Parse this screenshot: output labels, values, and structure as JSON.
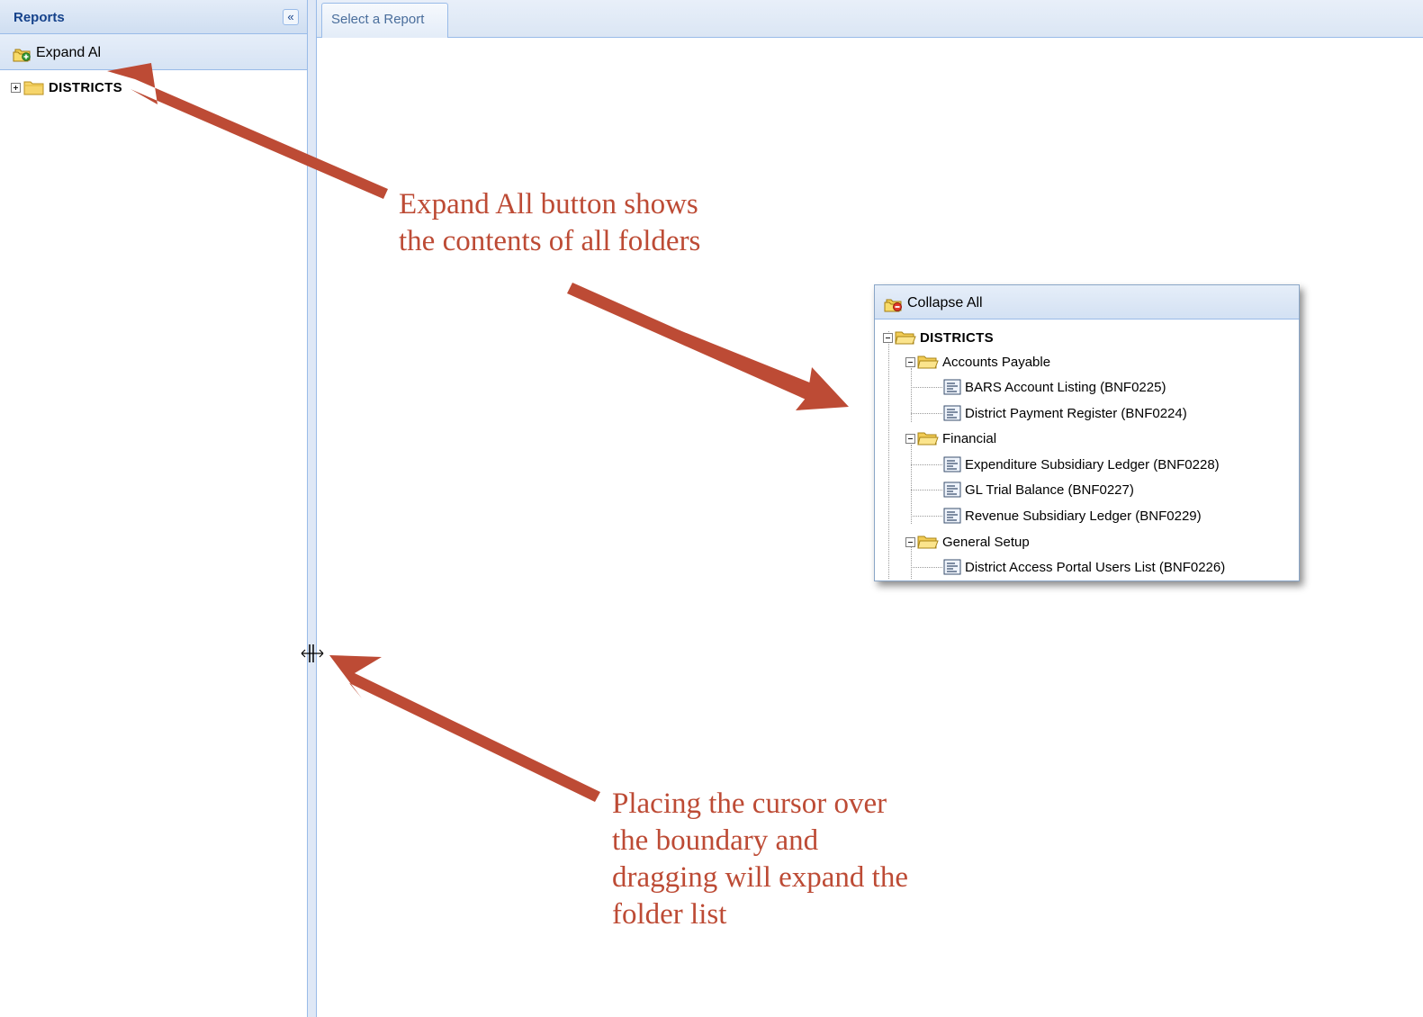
{
  "left_panel": {
    "title": "Reports",
    "collapse_icon": "double-chevron-left-icon",
    "collapse_glyph": "«",
    "expand_all_label": "Expand Al",
    "tree_root": "DISTRICTS"
  },
  "tabs": [
    {
      "label": "Select a Report"
    }
  ],
  "inset": {
    "collapse_all_label": "Collapse All",
    "tree": {
      "root": "DISTRICTS",
      "folders": [
        {
          "label": "Accounts Payable",
          "reports": [
            "BARS Account Listing (BNF0225)",
            "District Payment Register (BNF0224)"
          ]
        },
        {
          "label": "Financial",
          "reports": [
            "Expenditure Subsidiary Ledger (BNF0228)",
            "GL Trial Balance (BNF0227)",
            "Revenue Subsidiary Ledger (BNF0229)"
          ]
        },
        {
          "label": "General Setup",
          "reports": [
            "District Access Portal Users List (BNF0226)"
          ]
        }
      ]
    }
  },
  "annotations": {
    "expand_all_note": [
      "Expand All button shows",
      "the contents of all folders"
    ],
    "boundary_note": [
      "Placing the cursor over",
      "the boundary and",
      "dragging will expand the",
      "folder list"
    ]
  },
  "colors": {
    "annotation": "#bd4b35",
    "panel_border": "#99bbe8",
    "header_text": "#15428b"
  }
}
